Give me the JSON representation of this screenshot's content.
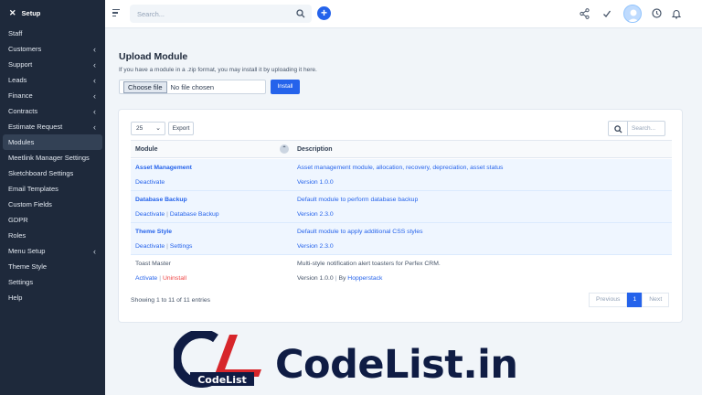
{
  "sidebar": {
    "header": "Setup",
    "items": [
      {
        "label": "Staff",
        "chevron": false
      },
      {
        "label": "Customers",
        "chevron": true
      },
      {
        "label": "Support",
        "chevron": true
      },
      {
        "label": "Leads",
        "chevron": true
      },
      {
        "label": "Finance",
        "chevron": true
      },
      {
        "label": "Contracts",
        "chevron": true
      },
      {
        "label": "Estimate Request",
        "chevron": true
      },
      {
        "label": "Modules",
        "chevron": false,
        "active": true
      },
      {
        "label": "Meetlink Manager Settings",
        "chevron": false
      },
      {
        "label": "Sketchboard Settings",
        "chevron": false
      },
      {
        "label": "Email Templates",
        "chevron": false
      },
      {
        "label": "Custom Fields",
        "chevron": false
      },
      {
        "label": "GDPR",
        "chevron": false
      },
      {
        "label": "Roles",
        "chevron": false
      },
      {
        "label": "Menu Setup",
        "chevron": true
      },
      {
        "label": "Theme Style",
        "chevron": false
      },
      {
        "label": "Settings",
        "chevron": false
      },
      {
        "label": "Help",
        "chevron": false
      }
    ]
  },
  "topbar": {
    "search_placeholder": "Search...",
    "icons": [
      "share-icon",
      "check-icon",
      "avatar",
      "clock-icon",
      "bell-icon"
    ]
  },
  "upload": {
    "title": "Upload Module",
    "description": "If you have a module in a .zip format, you may install it by uploading it here.",
    "choose_label": "Choose file",
    "no_file": "No file chosen",
    "install_label": "Install"
  },
  "table": {
    "page_length": "25",
    "export_label": "Export",
    "search_placeholder": "Search...",
    "headers": [
      "Module",
      "Description"
    ],
    "rows": [
      {
        "name": "Asset Management",
        "actions": [
          "Deactivate"
        ],
        "description": "Asset management module, allocation, recovery, depreciation, asset status",
        "version": "Version 1.0.0",
        "highlight": true
      },
      {
        "name": "Database Backup",
        "actions": [
          "Deactivate",
          "Database Backup"
        ],
        "description": "Default module to perform database backup",
        "version": "Version 2.3.0",
        "highlight": true
      },
      {
        "name": "Theme Style",
        "actions": [
          "Deactivate",
          "Settings"
        ],
        "description": "Default module to apply additional CSS styles",
        "version": "Version 2.3.0",
        "highlight": true
      },
      {
        "name": "Toast Master",
        "actions": [
          "Activate",
          "Uninstall"
        ],
        "description": "Multi-style notification alert toasters for Perfex CRM.",
        "version": "Version 1.0.0",
        "by_prefix": "By",
        "author": "Hopperstack",
        "highlight": false
      }
    ],
    "info": "Showing 1 to 11 of 11 entries",
    "pager": {
      "previous": "Previous",
      "current": "1",
      "next": "Next"
    }
  },
  "watermark": {
    "logo_letters": "CL",
    "logo_caption": "CodeList",
    "text": "CodeList.in"
  },
  "colors": {
    "sidebar_bg": "#1e293b",
    "accent": "#2563eb",
    "danger": "#ef4444",
    "watermark_dark": "#0f1c44",
    "watermark_red": "#d7262b"
  }
}
